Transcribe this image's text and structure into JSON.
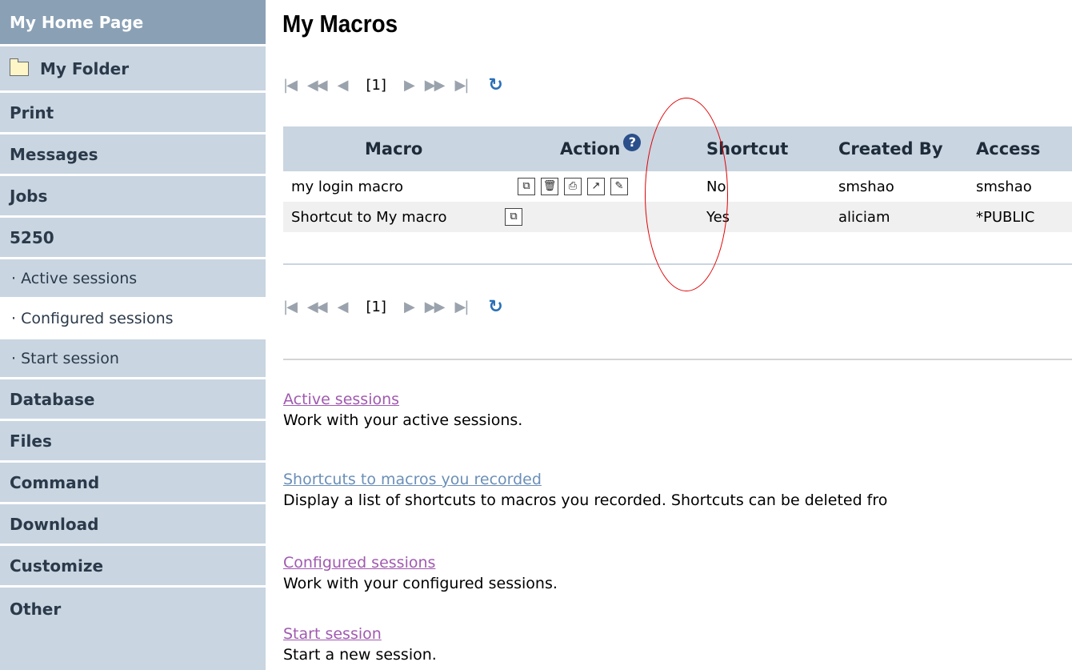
{
  "sidebar": {
    "home": "My Home Page",
    "folder": "My Folder",
    "items": [
      "Print",
      "Messages",
      "Jobs",
      "5250"
    ],
    "sub_items": [
      "Active sessions",
      "Configured sessions",
      "Start session"
    ],
    "items2": [
      "Database",
      "Files",
      "Command",
      "Download",
      "Customize",
      "Other"
    ]
  },
  "page": {
    "title": "My Macros"
  },
  "pager": {
    "page_number": "[1]"
  },
  "table": {
    "headers": {
      "macro": "Macro",
      "action": "Action",
      "shortcut": "Shortcut",
      "created_by": "Created By",
      "access": "Access"
    },
    "rows": [
      {
        "macro": "my login macro",
        "shortcut": "No",
        "created_by": "smshao",
        "access": "smshao",
        "actions": [
          "copy-icon",
          "delete-icon",
          "print-icon",
          "shortcut-icon",
          "edit-icon"
        ]
      },
      {
        "macro": "Shortcut to My macro",
        "shortcut": "Yes",
        "created_by": "aliciam",
        "access": "*PUBLIC",
        "actions": [
          "copy-icon"
        ]
      }
    ]
  },
  "links": [
    {
      "label": "Active sessions",
      "desc": "Work with your active sessions."
    },
    {
      "label": "Shortcuts to macros you recorded",
      "desc": "Display a list of shortcuts to macros you recorded. Shortcuts can be deleted fro"
    },
    {
      "label": "Configured sessions",
      "desc": "Work with your configured sessions."
    },
    {
      "label": "Start session",
      "desc": "Start a new session."
    }
  ],
  "colors": {
    "sidebar_bg": "#c9d5e1",
    "sidebar_top_bg": "#8aa0b5",
    "link_visited": "#a05ab0",
    "link": "#6b8fb8",
    "annotation_ellipse": "#e00000"
  }
}
